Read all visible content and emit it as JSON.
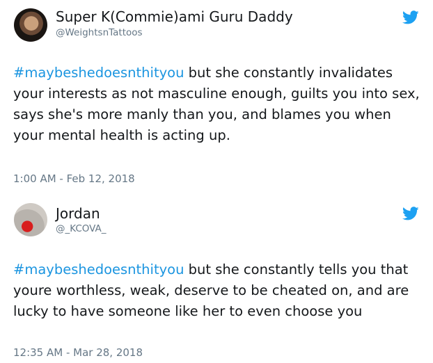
{
  "tweets": [
    {
      "display_name": "Super K(Commie)ami Guru Daddy",
      "handle": "@WeightsnTattoos",
      "hashtag": "#maybeshedoesnthityou",
      "body": " but she constantly invalidates your interests as not masculine enough, guilts you into sex, says she's more manly than you, and blames you when your mental health is acting up.",
      "timestamp": "1:00 AM - Feb 12, 2018",
      "avatar_icon": "profile-photo",
      "brand_icon": "twitter-bird-icon"
    },
    {
      "display_name": "Jordan",
      "handle": "@_KCOVA_",
      "hashtag": "#maybeshedoesnthityou",
      "body": " but she constantly tells you that youre worthless, weak, deserve to be cheated on, and are lucky to have someone like her to even choose you",
      "timestamp": "12:35 AM - Mar 28, 2018",
      "avatar_icon": "profile-photo",
      "brand_icon": "twitter-bird-icon"
    }
  ],
  "colors": {
    "hashtag": "#1b95e0",
    "twitter_blue": "#1da1f2",
    "secondary_text": "#657786",
    "primary_text": "#14171a"
  }
}
